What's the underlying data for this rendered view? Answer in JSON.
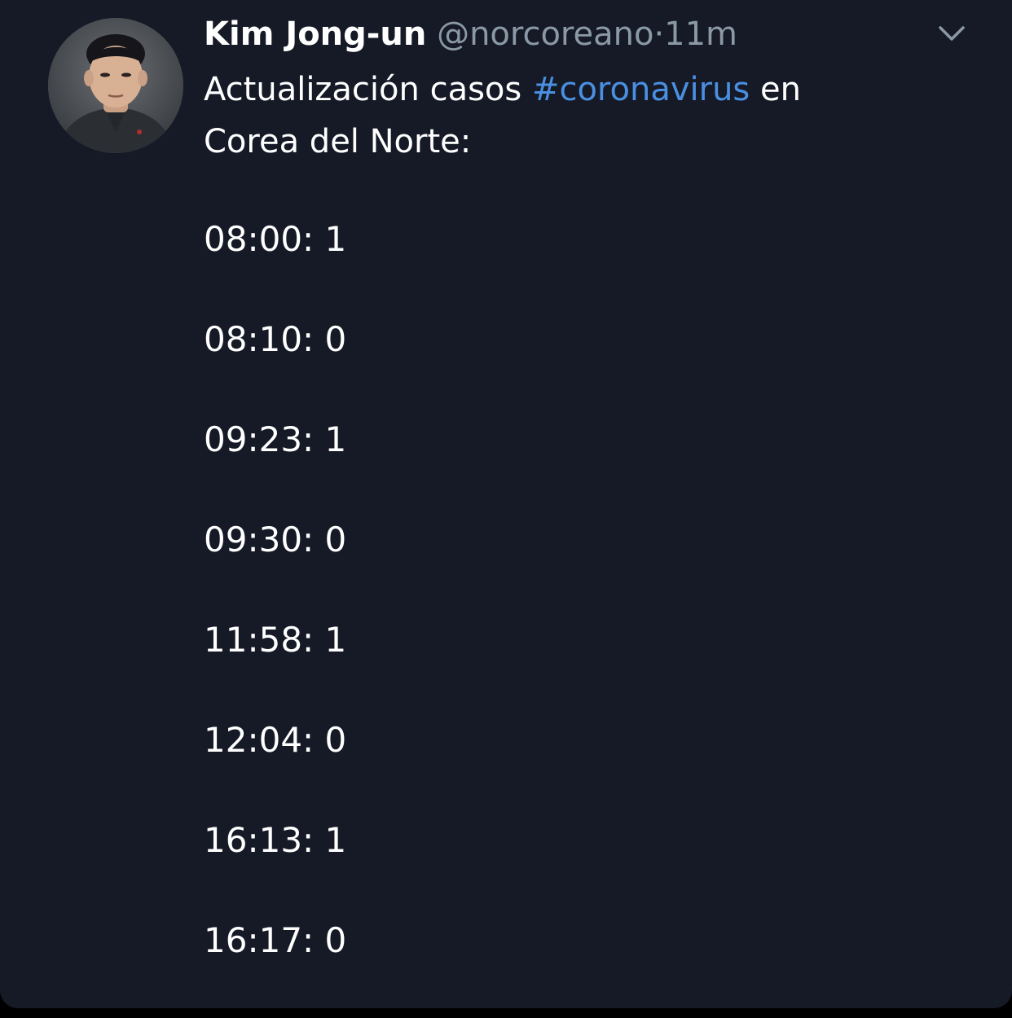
{
  "tweet": {
    "author": {
      "name": "Kim Jong-un",
      "handle": "@norcoreano",
      "separator": "·",
      "time": "11m"
    },
    "text": {
      "before_hashtag": "Actualización casos ",
      "hashtag": "#coronavirus",
      "after_hashtag": " en",
      "line2": "Corea del Norte:"
    },
    "updates": [
      "08:00: 1",
      "08:10: 0",
      "09:23: 1",
      "09:30: 0",
      "11:58: 1",
      "12:04: 0",
      "16:13: 1",
      "16:17: 0"
    ],
    "menu_icon": "chevron-down-icon",
    "colors": {
      "background": "#161a27",
      "text": "#ffffff",
      "muted": "#8b98a5",
      "hashtag": "#4a90e2"
    }
  }
}
